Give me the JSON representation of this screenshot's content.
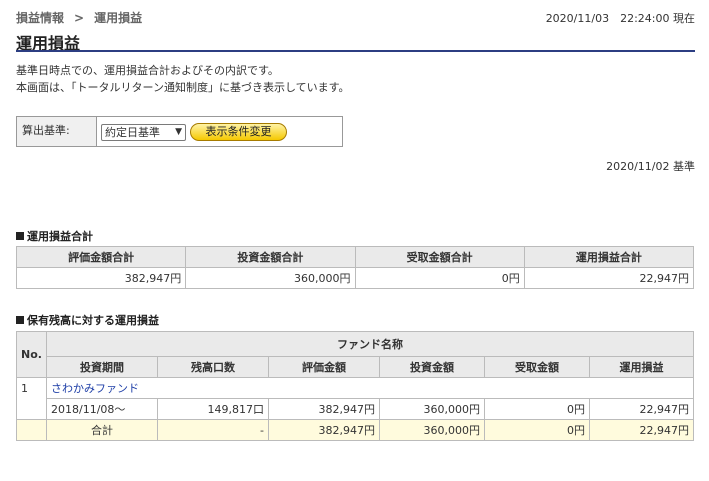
{
  "breadcrumb": {
    "parent": "損益情報",
    "separator": ">",
    "current": "運用損益"
  },
  "timestamp": "2020/11/03　22:24:00 現在",
  "page_title": "運用損益",
  "intro": {
    "line1": "基準日時点での、運用損益合計およびその内訳です。",
    "line2": "本画面は、「トータルリターン通知制度」に基づき表示しています。"
  },
  "filter": {
    "label": "算出基準:",
    "selected": "約定日基準",
    "button": "表示条件変更"
  },
  "base_date": "2020/11/02 基準",
  "summary": {
    "heading": "運用損益合計",
    "headers": [
      "評価金額合計",
      "投資金額合計",
      "受取金額合計",
      "運用損益合計"
    ],
    "values": [
      "382,947円",
      "360,000円",
      "0円",
      "22,947円"
    ]
  },
  "holdings": {
    "heading": "保有残高に対する運用損益",
    "no_header": "No.",
    "fund_name_header": "ファンド名称",
    "headers": [
      "投資期間",
      "残高口数",
      "評価金額",
      "投資金額",
      "受取金額",
      "運用損益"
    ],
    "funds": [
      {
        "no": "1",
        "name": "さわかみファンド",
        "row": [
          "2018/11/08～",
          "149,817口",
          "382,947円",
          "360,000円",
          "0円",
          "22,947円"
        ],
        "total": [
          "合計",
          "-",
          "382,947円",
          "360,000円",
          "0円",
          "22,947円"
        ]
      }
    ]
  }
}
